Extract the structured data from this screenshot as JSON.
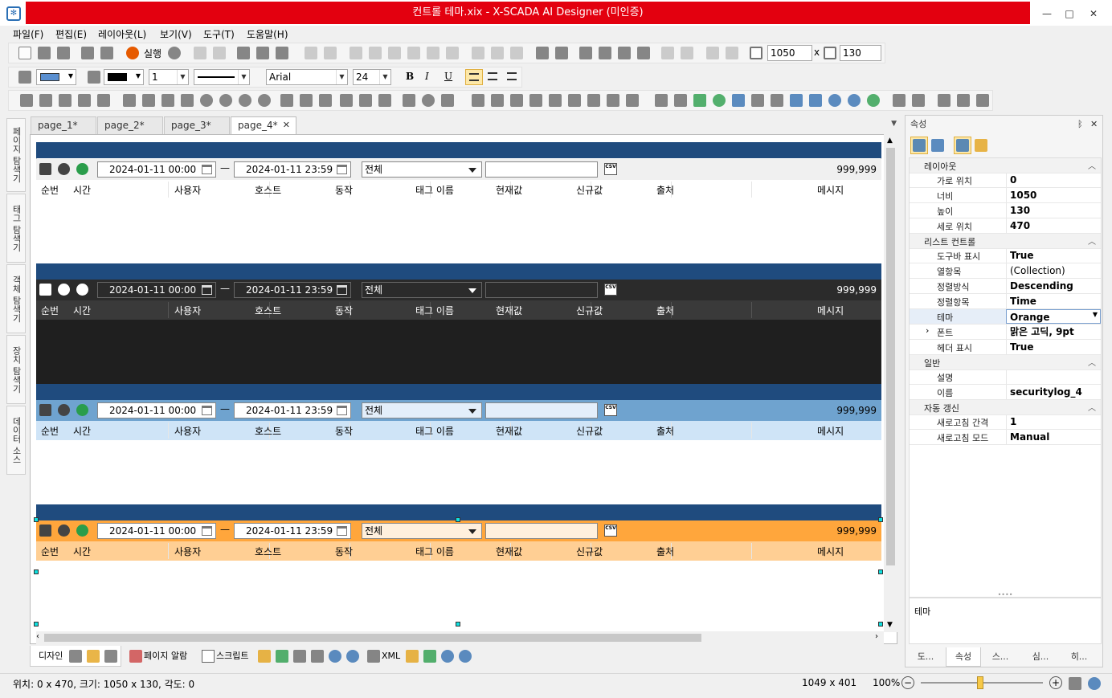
{
  "window": {
    "title": "컨트롤 테마.xix - X-SCADA AI Designer (미인증)",
    "app_icon": "xscada-app-icon",
    "buttons": [
      "minimize",
      "maximize",
      "close"
    ]
  },
  "menu": [
    "파일(F)",
    "편집(E)",
    "레이아웃(L)",
    "보기(V)",
    "도구(T)",
    "도움말(H)"
  ],
  "toolbar": {
    "run_label": "실행",
    "width_value": "1050",
    "times_sign": "x",
    "height_value": "130",
    "line_width": "1",
    "font_name": "Arial",
    "font_size": "24",
    "bold": "B",
    "italic": "I",
    "underline": "U"
  },
  "left_tabs": [
    "페이지 탐색기",
    "태그 탐색기",
    "객체 탐색기",
    "장치 탐색기",
    "데이터 소스"
  ],
  "doc_tabs": [
    "page_1*",
    "page_2*",
    "page_3*",
    "page_4*"
  ],
  "active_doc_tab": "page_4*",
  "log_controls": [
    {
      "theme": "Light",
      "start": "2024-01-11 00:00",
      "end": "2024-01-11 23:59",
      "dash": "—",
      "filter": "전체",
      "count": "999,999",
      "csv_label": "CSV",
      "colors": {
        "toolbar": "#f0f0f0",
        "header": "#ffffff",
        "body": "#ffffff",
        "text": "#000000"
      }
    },
    {
      "theme": "Dark",
      "start": "2024-01-11 00:00",
      "end": "2024-01-11 23:59",
      "dash": "—",
      "filter": "전체",
      "count": "999,999",
      "csv_label": "CSV",
      "colors": {
        "toolbar": "#2b2b2b",
        "header": "#3a3a3a",
        "body": "#1f1f1f",
        "text": "#ffffff"
      }
    },
    {
      "theme": "Blue",
      "start": "2024-01-11 00:00",
      "end": "2024-01-11 23:59",
      "dash": "—",
      "filter": "전체",
      "count": "999,999",
      "csv_label": "CSV",
      "colors": {
        "toolbar": "#6fa3cf",
        "header": "#cfe4f7",
        "body": "#ffffff",
        "text": "#000000"
      }
    },
    {
      "theme": "Orange",
      "start": "2024-01-11 00:00",
      "end": "2024-01-11 23:59",
      "dash": "—",
      "filter": "전체",
      "count": "999,999",
      "csv_label": "CSV",
      "colors": {
        "toolbar": "#ffa63c",
        "header": "#ffcf94",
        "body": "#ffffff",
        "text": "#000000"
      }
    }
  ],
  "columns": [
    "순번",
    "시간",
    "사용자",
    "호스트",
    "동작",
    "태그 이름",
    "현재값",
    "신규값",
    "출처",
    "메시지"
  ],
  "bottom_tabs": {
    "design": "디자인",
    "page_alarm": "페이지 알람",
    "script": "스크립트",
    "xml": "XML"
  },
  "status": {
    "position": "위치: 0 x 470, 크기: 1050 x 130, 각도: 0",
    "mouse": "1049 x 401",
    "zoom": "100%"
  },
  "properties": {
    "title": "속성",
    "pin": "ᛒ",
    "close": "✕",
    "rows": [
      {
        "type": "cat",
        "key": "레이아웃"
      },
      {
        "type": "prop",
        "key": "가로 위치",
        "value": "0"
      },
      {
        "type": "prop",
        "key": "너비",
        "value": "1050"
      },
      {
        "type": "prop",
        "key": "높이",
        "value": "130"
      },
      {
        "type": "prop",
        "key": "세로 위치",
        "value": "470"
      },
      {
        "type": "cat",
        "key": "리스트 컨트롤"
      },
      {
        "type": "prop",
        "key": "도구바 표시",
        "value": "True"
      },
      {
        "type": "prop",
        "key": "열항목",
        "value": "(Collection)",
        "plain": true
      },
      {
        "type": "prop",
        "key": "정렬방식",
        "value": "Descending"
      },
      {
        "type": "prop",
        "key": "정렬항목",
        "value": "Time"
      },
      {
        "type": "prop",
        "key": "테마",
        "value": "Orange",
        "selected": true
      },
      {
        "type": "prop",
        "key": "폰트",
        "value": "맑은 고딕, 9pt",
        "expand": true
      },
      {
        "type": "prop",
        "key": "헤더 표시",
        "value": "True"
      },
      {
        "type": "cat",
        "key": "일반"
      },
      {
        "type": "prop",
        "key": "설명",
        "value": ""
      },
      {
        "type": "prop",
        "key": "이름",
        "value": "securitylog_4"
      },
      {
        "type": "cat",
        "key": "자동 갱신"
      },
      {
        "type": "prop",
        "key": "새로고침 간격",
        "value": "1"
      },
      {
        "type": "prop",
        "key": "새로고침 모드",
        "value": "Manual"
      }
    ],
    "description_title": "테마",
    "tabs": [
      "도...",
      "속성",
      "스...",
      "심...",
      "히..."
    ],
    "active_tab": "속성"
  }
}
